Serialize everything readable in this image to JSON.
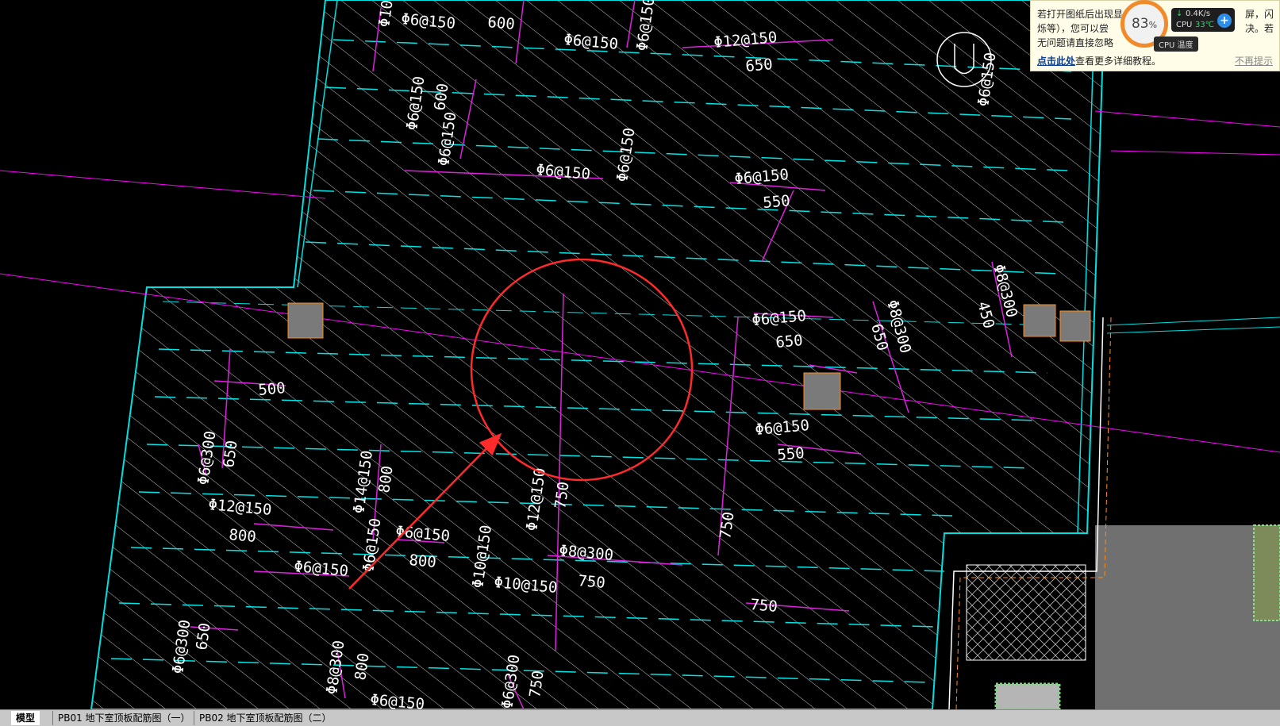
{
  "drawing": {
    "colors": {
      "background": "#000000",
      "slab_hatch": "#ffffff",
      "boundary": "#00e5e5",
      "rebar": "#e020e0",
      "column": "#7f7f7f",
      "annotation": "#ff2a2a",
      "grid_axis": "#ff00ff"
    },
    "labels": [
      "Φ6@150",
      "600",
      "Φ6@150",
      "Φ10@",
      "Φ6@150",
      "Φ12@150",
      "650",
      "Φ6@150",
      "Φ6@150",
      "600",
      "Φ6@150",
      "Φ6@150",
      "Φ6@150",
      "Φ6@150",
      "550",
      "Φ8@300",
      "450",
      "Φ6@150",
      "650",
      "Φ8@300",
      "650",
      "500",
      "Φ6@300",
      "650",
      "Φ6@150",
      "550",
      "Φ14@150",
      "800",
      "Φ12@150",
      "800",
      "Φ6@150",
      "800",
      "Φ6@150",
      "Φ6@150",
      "Φ12@150",
      "750",
      "Φ10@150",
      "Φ8@300",
      "750",
      "Φ10@150",
      "750",
      "750",
      "Φ6@300",
      "650",
      "Φ8@300",
      "800",
      "Φ6@150",
      "750",
      "Φ6@300"
    ]
  },
  "tabs": [
    {
      "label": "模型"
    },
    {
      "label": "PB01 地下室顶板配筋图（一）"
    },
    {
      "label": "PB02 地下室顶板配筋图（二）"
    }
  ],
  "notification": {
    "line1": "若打开图纸后出现显",
    "line1_right": "屏，闪",
    "line2": "烁等），您可以尝",
    "line2_right": "决。若",
    "line3": "无问题请直接忽略",
    "link": "点击此处",
    "link_suffix": "查看更多详细教程。",
    "dismiss": "不再提示"
  },
  "monitor": {
    "cpu_load": "83",
    "percent_sign": "%",
    "net_speed": "0.4K/s",
    "cpu_label": "CPU",
    "cpu_temp": "33℃",
    "temp_title": "CPU 温度",
    "plus_icon": "plus-icon"
  }
}
